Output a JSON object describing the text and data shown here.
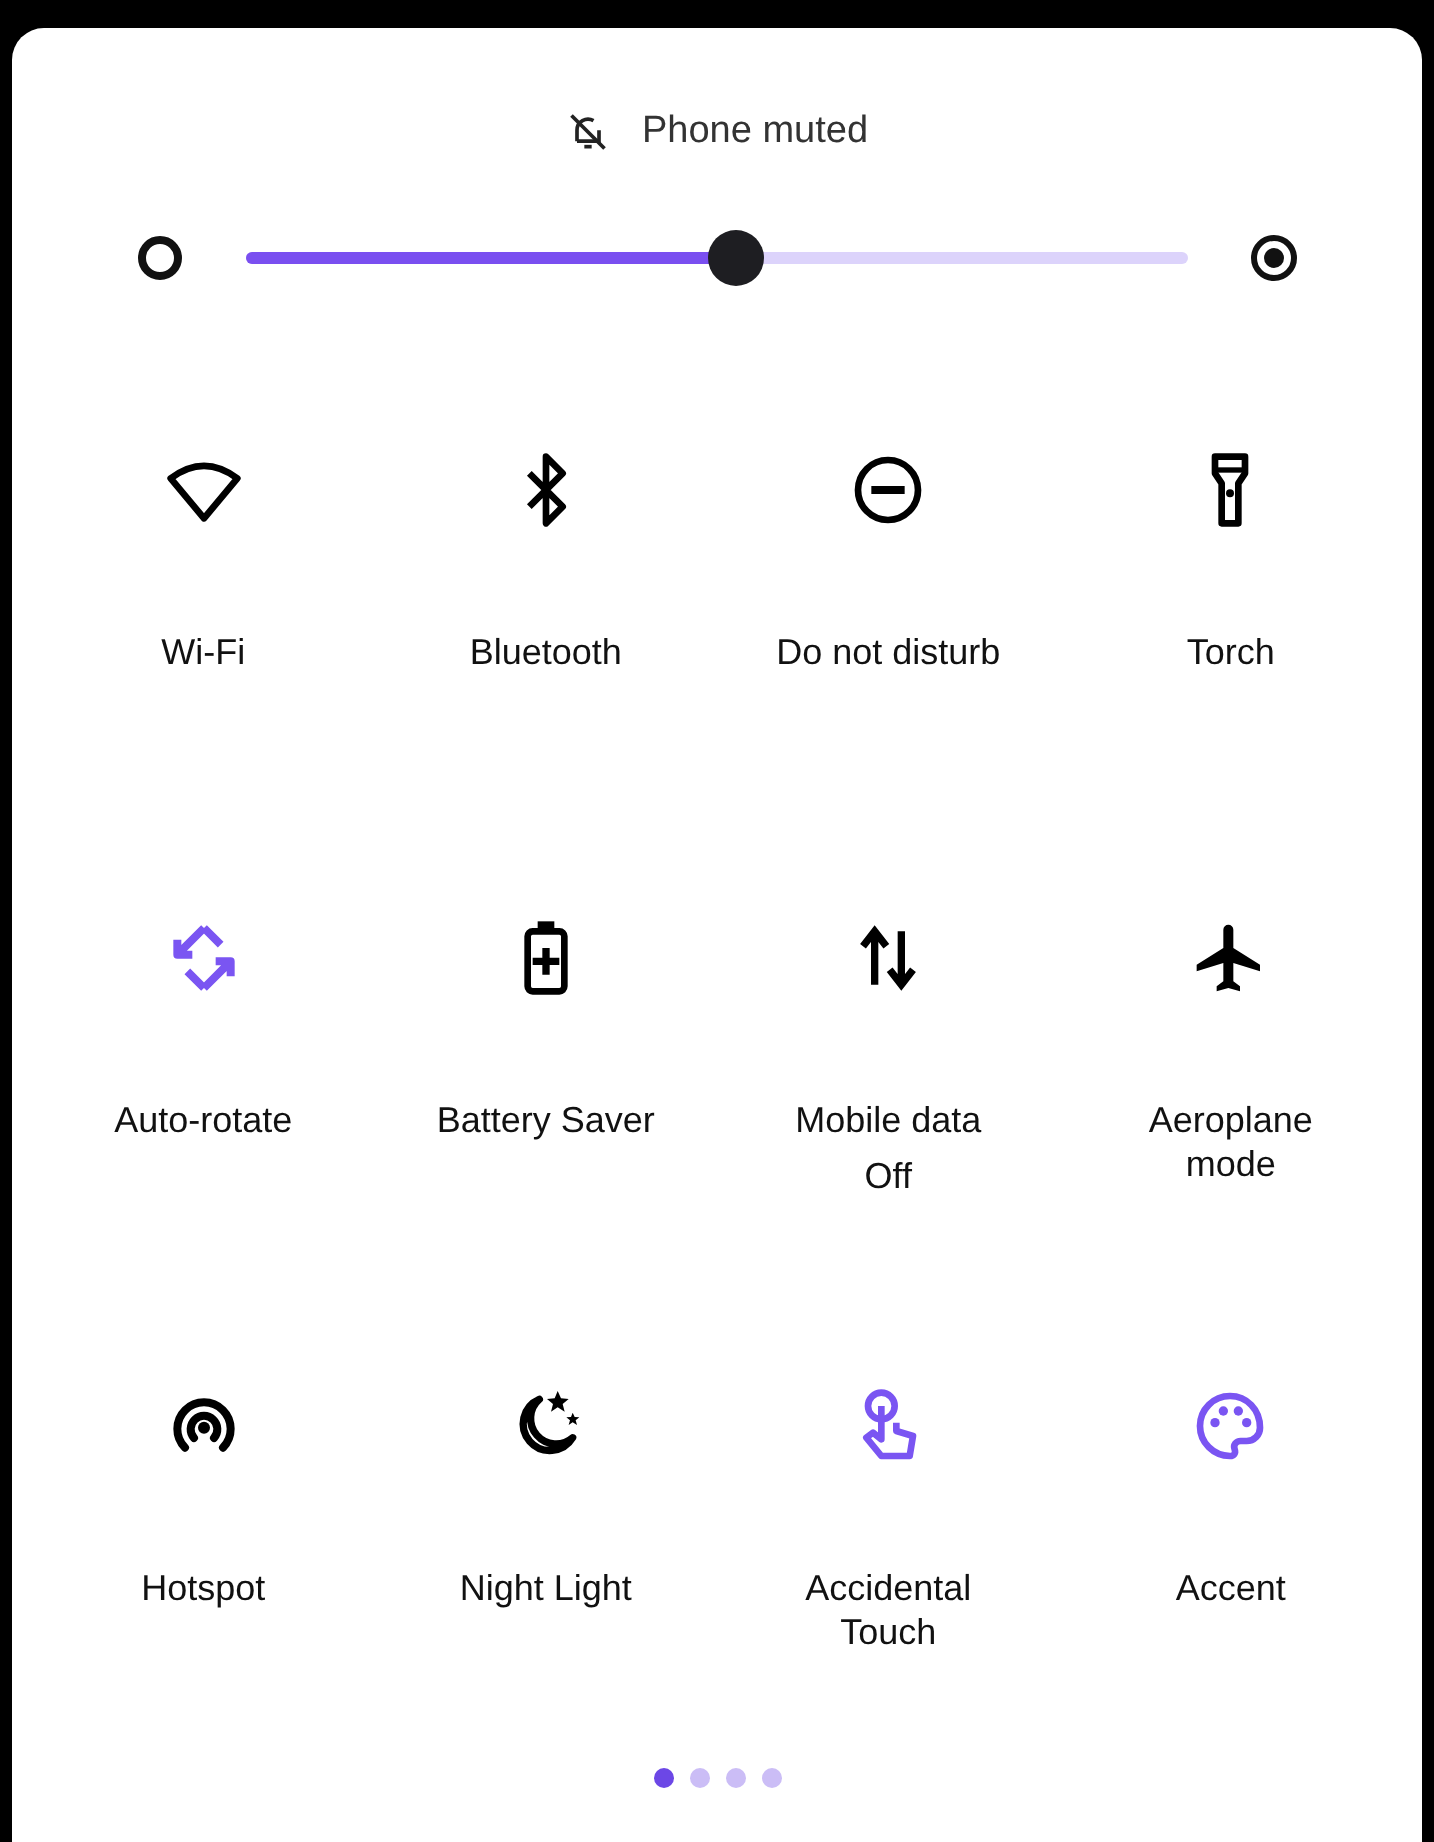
{
  "status": {
    "text": "Phone muted"
  },
  "volume_slider": {
    "level": 0.52
  },
  "tiles": [
    {
      "kind": "wifi",
      "label": "Wi-Fi",
      "on": false
    },
    {
      "kind": "bluetooth",
      "label": "Bluetooth",
      "on": false
    },
    {
      "kind": "dnd",
      "label": "Do not disturb",
      "on": false
    },
    {
      "kind": "torch",
      "label": "Torch",
      "on": false
    },
    {
      "kind": "rotate",
      "label": "Auto-rotate",
      "on": true
    },
    {
      "kind": "battery",
      "label": "Battery Saver",
      "on": false
    },
    {
      "kind": "data",
      "label": "Mobile data",
      "sublabel": "Off",
      "on": false
    },
    {
      "kind": "plane",
      "label": "Aeroplane mode",
      "on": false
    },
    {
      "kind": "hotspot",
      "label": "Hotspot",
      "on": false
    },
    {
      "kind": "night",
      "label": "Night Light",
      "on": false
    },
    {
      "kind": "touch",
      "label": "Accidental Touch",
      "on": true
    },
    {
      "kind": "palette",
      "label": "Accent",
      "on": true
    }
  ],
  "page_dots": [
    {
      "selected": true
    },
    {
      "selected": false
    },
    {
      "selected": false
    },
    {
      "selected": false
    }
  ]
}
